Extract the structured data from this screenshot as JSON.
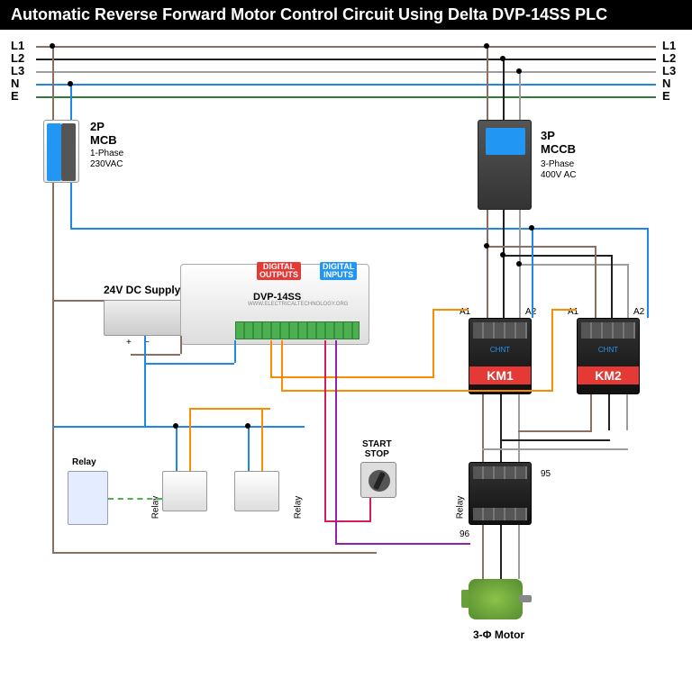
{
  "title": "Automatic Reverse Forward Motor Control Circuit Using Delta DVP-14SS PLC",
  "rails": {
    "L1": "L1",
    "L2": "L2",
    "L3": "L3",
    "N": "N",
    "E": "E"
  },
  "mcb": {
    "label": "2P\nMCB",
    "sub1": "1-Phase",
    "sub2": "230VAC"
  },
  "mccb": {
    "label": "3P\nMCCB",
    "sub1": "3-Phase",
    "sub2": "400V AC"
  },
  "psu": {
    "label": "24V DC Supply",
    "plus": "+",
    "minus": "−"
  },
  "plc": {
    "model": "DVP-14SS",
    "url": "WWW.ELECTRICALTECHNOLOGY.ORG",
    "dout": "DIGITAL\nOUTPUTS",
    "din": "DIGITAL\nINPUTS"
  },
  "km1": "KM1",
  "km2": "KM2",
  "a1": "A1",
  "a2": "A2",
  "ovr_95": "95",
  "ovr_96": "96",
  "relay": "Relay",
  "startstop": "START\nSTOP",
  "motor": "3-Φ Motor",
  "chint": "CHNT",
  "colors": {
    "L1": "#8d6e63",
    "L2": "#212121",
    "L3": "#9e9e9e",
    "N": "#1e88e5",
    "E": "#2e7d32",
    "dc_brown": "#8d6e63",
    "dc_blue": "#1e88e5",
    "orange": "#fb8c00",
    "magenta": "#d81b60",
    "purple": "#8e24aa"
  }
}
